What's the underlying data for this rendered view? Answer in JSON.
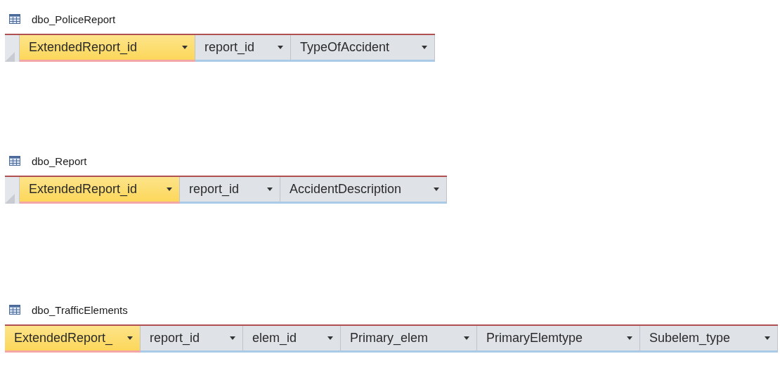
{
  "tables": [
    {
      "title": "dbo_PoliceReport",
      "columns": [
        {
          "label": "ExtendedReport_id",
          "selected": true
        },
        {
          "label": "report_id",
          "selected": false
        },
        {
          "label": "TypeOfAccident",
          "selected": false
        }
      ]
    },
    {
      "title": "dbo_Report",
      "columns": [
        {
          "label": "ExtendedReport_id",
          "selected": true
        },
        {
          "label": "report_id",
          "selected": false
        },
        {
          "label": "AccidentDescription",
          "selected": false
        }
      ]
    },
    {
      "title": "dbo_TrafficElements",
      "columns": [
        {
          "label": "ExtendedReport_",
          "selected": true
        },
        {
          "label": "report_id",
          "selected": false
        },
        {
          "label": "elem_id",
          "selected": false
        },
        {
          "label": "Primary_elem",
          "selected": false
        },
        {
          "label": "PrimaryElemtype",
          "selected": false
        },
        {
          "label": "Subelem_type",
          "selected": false
        }
      ]
    }
  ]
}
